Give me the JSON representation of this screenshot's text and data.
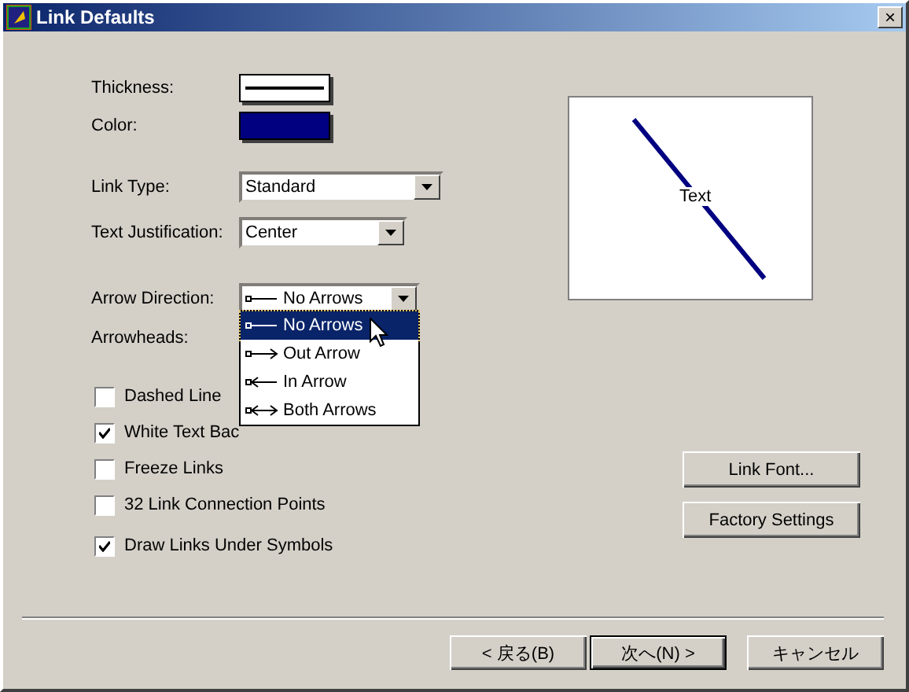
{
  "window": {
    "title": "Link Defaults",
    "close": "×"
  },
  "thickness": {
    "label": "Thickness:"
  },
  "color": {
    "label": "Color:",
    "color": "#000080"
  },
  "link_type": {
    "label": "Link Type:",
    "value": "Standard"
  },
  "text_justification": {
    "label": "Text Justification:",
    "value": "Center"
  },
  "arrow_direction": {
    "label": "Arrow Direction:",
    "value": "No Arrows",
    "expanded": true,
    "options": [
      {
        "label": "No Arrows",
        "kind": "none",
        "selected": true
      },
      {
        "label": "Out Arrow",
        "kind": "out",
        "selected": false
      },
      {
        "label": "In Arrow",
        "kind": "in",
        "selected": false
      },
      {
        "label": "Both Arrows",
        "kind": "both",
        "selected": false
      }
    ]
  },
  "arrowheads": {
    "label": "Arrowheads:"
  },
  "checkboxes": [
    {
      "label": "Dashed Line",
      "checked": false
    },
    {
      "label": "White Text Bac",
      "checked": true
    },
    {
      "label": "Freeze Links",
      "checked": false
    },
    {
      "label": "32 Link Connection Points",
      "checked": false
    },
    {
      "label": "Draw Links Under Symbols",
      "checked": true
    }
  ],
  "preview": {
    "text": "Text"
  },
  "side_buttons": [
    "Link Font...",
    "Factory Settings"
  ],
  "footer_buttons": [
    {
      "label": "< 戻る(B)",
      "default": false
    },
    {
      "label": "次へ(N) >",
      "default": true
    },
    {
      "label": "キャンセル",
      "default": false
    }
  ]
}
